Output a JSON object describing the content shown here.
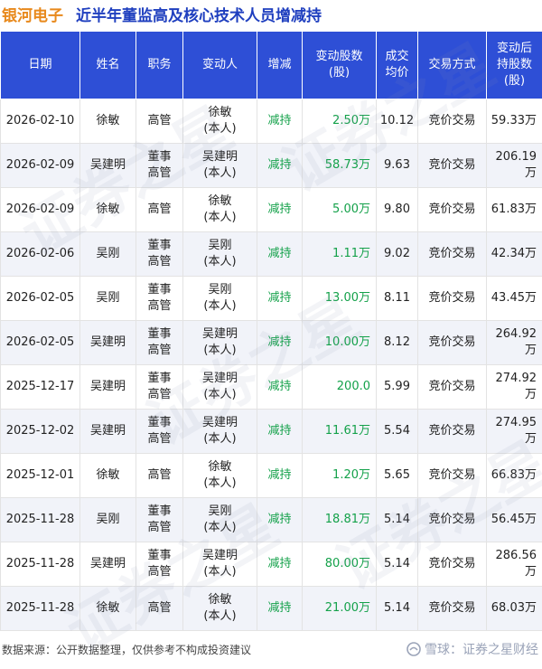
{
  "header": {
    "company": "银河电子",
    "subtitle": "近半年董监高及核心技术人员增减持"
  },
  "table": {
    "columns": [
      [
        "日期"
      ],
      [
        "姓名"
      ],
      [
        "职务"
      ],
      [
        "变动人"
      ],
      [
        "增减"
      ],
      [
        "变动股数",
        "(股)"
      ],
      [
        "成交",
        "均价"
      ],
      [
        "交易方式"
      ],
      [
        "变动后",
        "持股数",
        "(股)"
      ]
    ],
    "rows": [
      {
        "date": "2026-02-10",
        "name": "徐敏",
        "role": [
          "高管"
        ],
        "person": [
          "徐敏",
          "(本人)"
        ],
        "dir": "减持",
        "shares": "2.50万",
        "price": "10.12",
        "method": "竞价交易",
        "after": "59.33万"
      },
      {
        "date": "2026-02-09",
        "name": "吴建明",
        "role": [
          "董事",
          "高管"
        ],
        "person": [
          "吴建明",
          "(本人)"
        ],
        "dir": "减持",
        "shares": "58.73万",
        "price": "9.63",
        "method": "竞价交易",
        "after": "206.19万"
      },
      {
        "date": "2026-02-09",
        "name": "徐敏",
        "role": [
          "高管"
        ],
        "person": [
          "徐敏",
          "(本人)"
        ],
        "dir": "减持",
        "shares": "5.00万",
        "price": "9.80",
        "method": "竞价交易",
        "after": "61.83万"
      },
      {
        "date": "2026-02-06",
        "name": "吴刚",
        "role": [
          "董事",
          "高管"
        ],
        "person": [
          "吴刚",
          "(本人)"
        ],
        "dir": "减持",
        "shares": "1.11万",
        "price": "9.02",
        "method": "竞价交易",
        "after": "42.34万"
      },
      {
        "date": "2026-02-05",
        "name": "吴刚",
        "role": [
          "董事",
          "高管"
        ],
        "person": [
          "吴刚",
          "(本人)"
        ],
        "dir": "减持",
        "shares": "13.00万",
        "price": "8.11",
        "method": "竞价交易",
        "after": "43.45万"
      },
      {
        "date": "2026-02-05",
        "name": "吴建明",
        "role": [
          "董事",
          "高管"
        ],
        "person": [
          "吴建明",
          "(本人)"
        ],
        "dir": "减持",
        "shares": "10.00万",
        "price": "8.12",
        "method": "竞价交易",
        "after": "264.92万"
      },
      {
        "date": "2025-12-17",
        "name": "吴建明",
        "role": [
          "董事",
          "高管"
        ],
        "person": [
          "吴建明",
          "(本人)"
        ],
        "dir": "减持",
        "shares": "200.0",
        "price": "5.99",
        "method": "竞价交易",
        "after": "274.92万"
      },
      {
        "date": "2025-12-02",
        "name": "吴建明",
        "role": [
          "董事",
          "高管"
        ],
        "person": [
          "吴建明",
          "(本人)"
        ],
        "dir": "减持",
        "shares": "11.61万",
        "price": "5.54",
        "method": "竞价交易",
        "after": "274.95万"
      },
      {
        "date": "2025-12-01",
        "name": "徐敏",
        "role": [
          "高管"
        ],
        "person": [
          "徐敏",
          "(本人)"
        ],
        "dir": "减持",
        "shares": "1.20万",
        "price": "5.65",
        "method": "竞价交易",
        "after": "66.83万"
      },
      {
        "date": "2025-11-28",
        "name": "吴刚",
        "role": [
          "董事",
          "高管"
        ],
        "person": [
          "吴刚",
          "(本人)"
        ],
        "dir": "减持",
        "shares": "18.81万",
        "price": "5.14",
        "method": "竞价交易",
        "after": "56.45万"
      },
      {
        "date": "2025-11-28",
        "name": "吴建明",
        "role": [
          "董事",
          "高管"
        ],
        "person": [
          "吴建明",
          "(本人)"
        ],
        "dir": "减持",
        "shares": "80.00万",
        "price": "5.14",
        "method": "竞价交易",
        "after": "286.56万"
      },
      {
        "date": "2025-11-28",
        "name": "徐敏",
        "role": [
          "高管"
        ],
        "person": [
          "徐敏",
          "(本人)"
        ],
        "dir": "减持",
        "shares": "21.00万",
        "price": "5.14",
        "method": "竞价交易",
        "after": "68.03万"
      }
    ]
  },
  "footer": {
    "source": "数据来源：公开数据整理，仅供参考不构成投资建议",
    "brand": "雪球：证券之星财经"
  },
  "watermark": "证券之星"
}
